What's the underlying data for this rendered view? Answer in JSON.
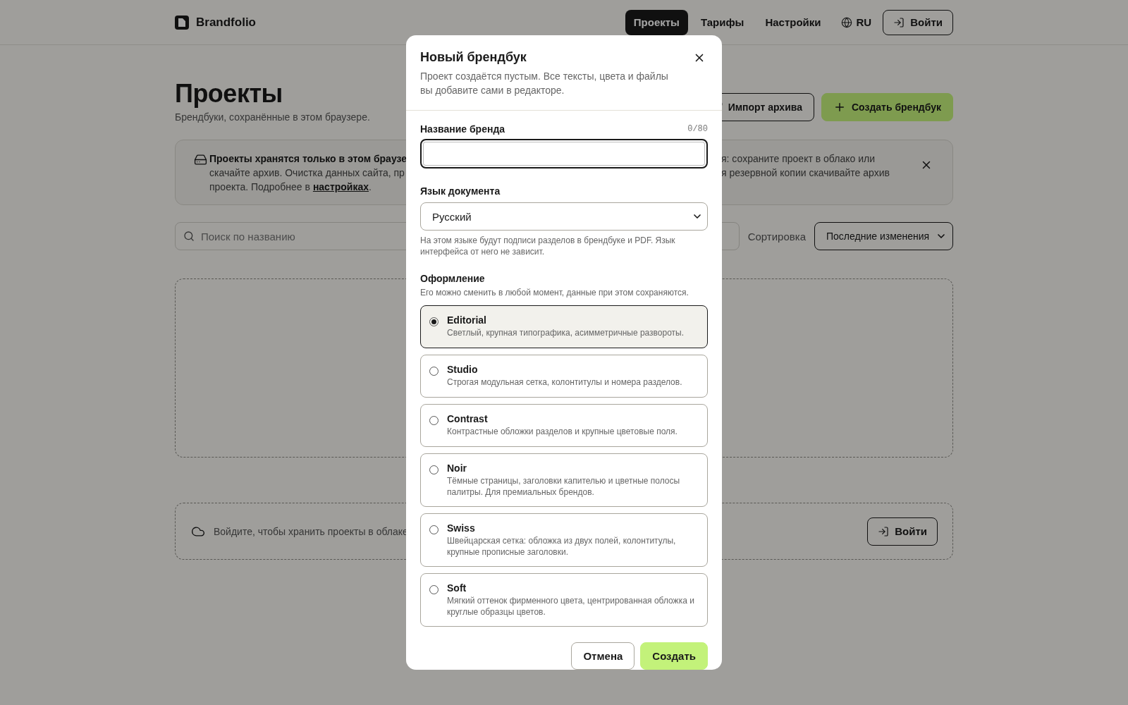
{
  "header": {
    "logo": "Brandfolio",
    "nav": [
      {
        "label": "Проекты",
        "selected": true
      },
      {
        "label": "Тарифы",
        "selected": false
      },
      {
        "label": "Настройки",
        "selected": false
      }
    ],
    "language": "RU",
    "login": "Войти"
  },
  "page": {
    "title": "Проекты",
    "subtitle": "Брендбуки, сохранённые в этом браузере.",
    "import_button": "Импорт архива",
    "create_button": "Создать брендбук"
  },
  "banner": {
    "left_title": "Проекты хранятся только в этом браузе",
    "left_line": "скачайте архив. Очистка данных сайта, пр",
    "link_prefix": "проекта. Подробнее в",
    "link": "настройках",
    "link_suffix": ".",
    "right_lines": [
      "я: сохраните проект в облако или",
      "я резервной копии скачивайте архив"
    ]
  },
  "search": {
    "placeholder": "Поиск по названию",
    "sort_label": "Сортировка",
    "sort_value": "Последние изменения"
  },
  "cloud": {
    "text": "Войдите, чтобы хранить проекты в облаке",
    "login": "Войти"
  },
  "dialog": {
    "title": "Новый брендбук",
    "description": "Проект создаётся пустым. Все тексты, цвета и файлы вы добавите сами в редакторе.",
    "name_field": {
      "label": "Название бренда",
      "counter": "0/80"
    },
    "language_field": {
      "label": "Язык документа",
      "value": "Русский",
      "hint": "На этом языке будут подписи разделов в брендбуке и PDF. Язык интерфейса от него не зависит."
    },
    "style": {
      "label": "Оформление",
      "hint": "Его можно сменить в любой момент, данные при этом сохраняются.",
      "options": [
        {
          "name": "Editorial",
          "description": "Светлый, крупная типографика, асимметричные развороты.",
          "selected": true
        },
        {
          "name": "Studio",
          "description": "Строгая модульная сетка, колонтитулы и номера разделов.",
          "selected": false
        },
        {
          "name": "Contrast",
          "description": "Контрастные обложки разделов и крупные цветовые поля.",
          "selected": false
        },
        {
          "name": "Noir",
          "description": "Тёмные страницы, заголовки капителью и цветные полосы палитры. Для премиальных брендов.",
          "selected": false
        },
        {
          "name": "Swiss",
          "description": "Швейцарская сетка: обложка из двух полей, колонтитулы, крупные прописные заголовки.",
          "selected": false
        },
        {
          "name": "Soft",
          "description": "Мягкий оттенок фирменного цвета, центрированная обложка и круглые образцы цветов.",
          "selected": false
        }
      ]
    },
    "cancel": "Отмена",
    "create": "Создать"
  }
}
